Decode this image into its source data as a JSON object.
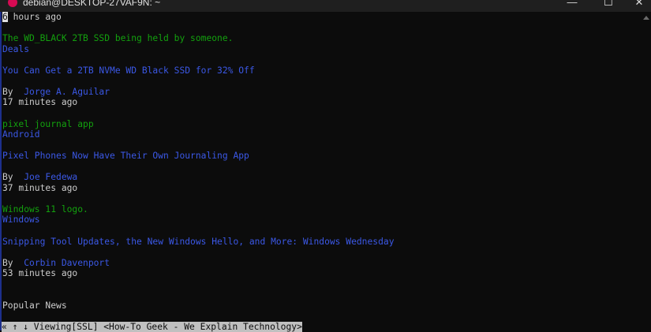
{
  "window": {
    "title": "debian@DESKTOP-27VAF9N: ~",
    "minimize": "—",
    "maximize": "☐",
    "close": "✕"
  },
  "lines": {
    "l0_cursor": "6",
    "l0_rest": " hours ago",
    "l2": "The WD_BLACK 2TB SSD being held by someone.",
    "l3": "Deals",
    "l5": "You Can Get a 2TB NVMe WD Black SSD for 32% Off",
    "l7_by": "By  ",
    "l7_author": "Jorge A. Aguilar",
    "l8": "17 minutes ago",
    "l10": "pixel journal app",
    "l11": "Android",
    "l13": "Pixel Phones Now Have Their Own Journaling App",
    "l15_by": "By  ",
    "l15_author": "Joe Fedewa",
    "l16": "37 minutes ago",
    "l18": "Windows 11 logo.",
    "l19": "Windows",
    "l21": "Snipping Tool Updates, the New Windows Hello, and More: Windows Wednesday",
    "l23_by": "By  ",
    "l23_author": "Corbin Davenport",
    "l24": "53 minutes ago",
    "l27": "Popular News"
  },
  "status": "« ↑ ↓ Viewing[SSL] <How-To Geek - We Explain Technology>",
  "colors": {
    "green": "#13a10e",
    "blue": "#3b58e6",
    "text": "#cccccc",
    "bg": "#0c0c0c"
  }
}
